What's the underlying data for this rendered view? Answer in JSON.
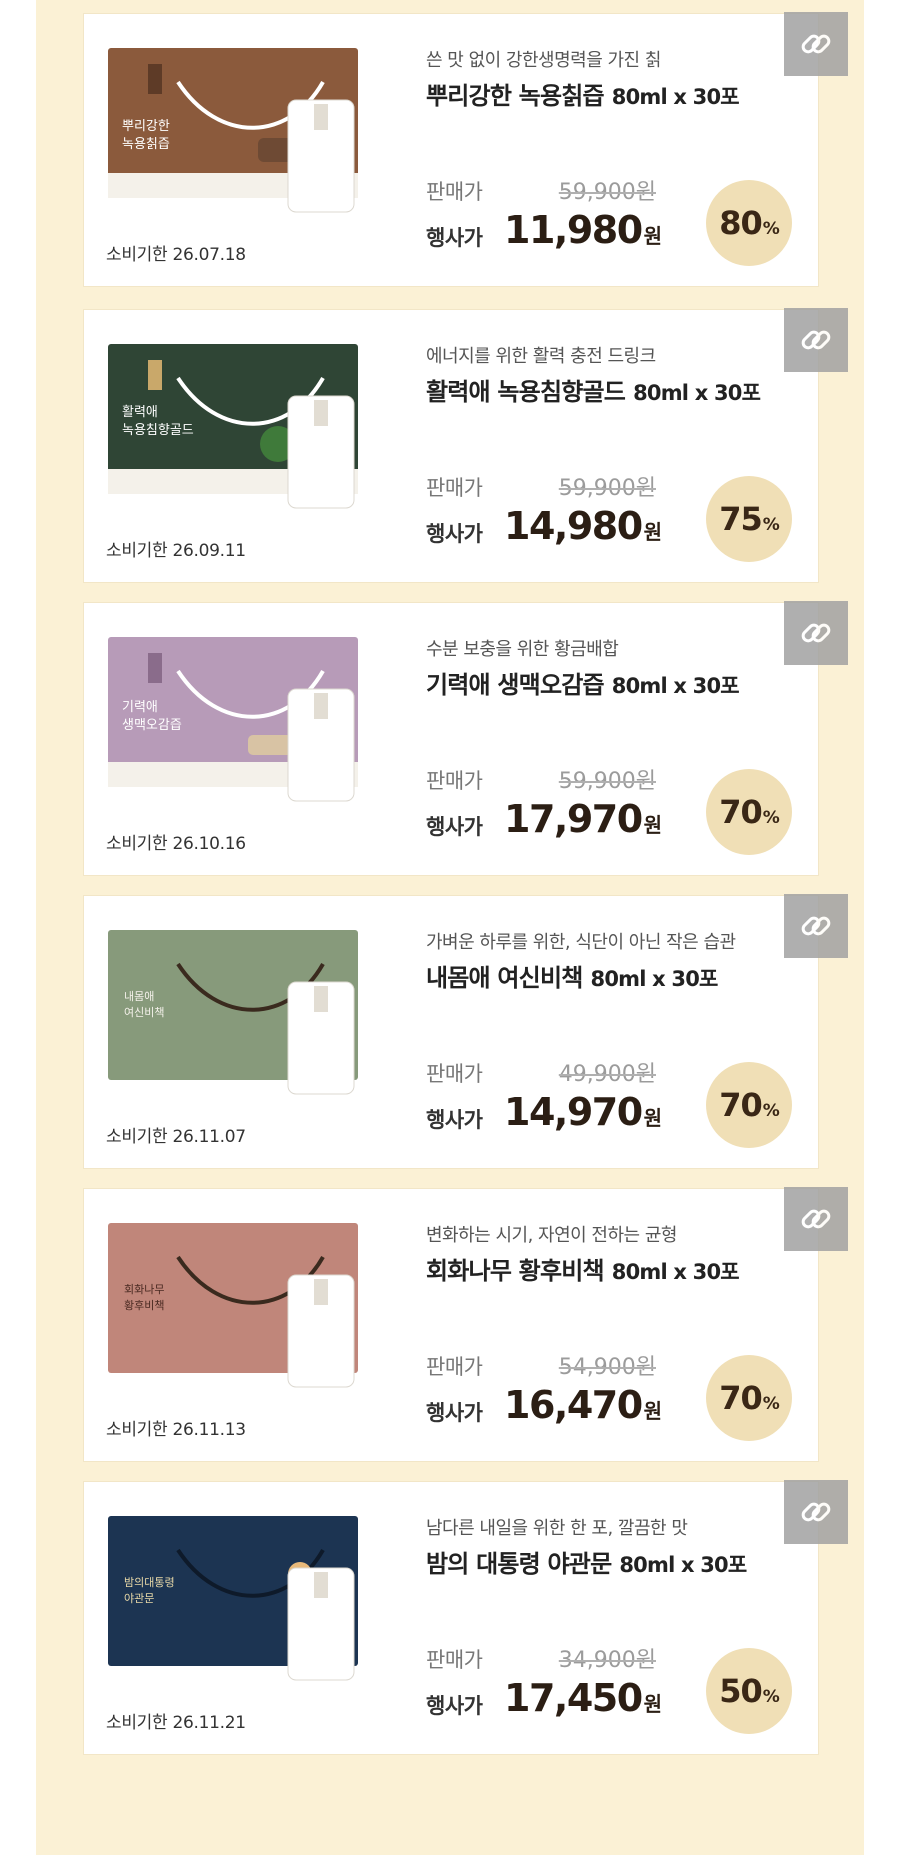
{
  "products": [
    {
      "subtitle": "쓴 맛 없이 강한생명력을 가진 칡",
      "name": "뿌리강한 녹용칡즙",
      "size": "80ml x 30포",
      "sale_label": "판매가",
      "original_price": "59,900원",
      "event_label": "행사가",
      "event_price": "11,980",
      "won": "원",
      "discount": "80",
      "pct": "%",
      "expiry": "소비기한 26.07.18",
      "box_label": "뿌리강한\n녹용칡즙",
      "box_color": "#8b5a3c",
      "link_icon": "link-icon"
    },
    {
      "subtitle": "에너지를 위한 활력 충전 드링크",
      "name": "활력애 녹용침향골드",
      "size": "80ml x 30포",
      "sale_label": "판매가",
      "original_price": "59,900원",
      "event_label": "행사가",
      "event_price": "14,980",
      "won": "원",
      "discount": "75",
      "pct": "%",
      "expiry": "소비기한 26.09.11",
      "box_label": "활력애\n녹용침향골드",
      "box_color": "#2f4535",
      "link_icon": "link-icon"
    },
    {
      "subtitle": "수분 보충을 위한 황금배합",
      "name": "기력애 생맥오감즙",
      "size": "80ml x 30포",
      "sale_label": "판매가",
      "original_price": "59,900원",
      "event_label": "행사가",
      "event_price": "17,970",
      "won": "원",
      "discount": "70",
      "pct": "%",
      "expiry": "소비기한 26.10.16",
      "box_label": "기력애\n생맥오감즙",
      "box_color": "#b79bb8",
      "link_icon": "link-icon"
    },
    {
      "subtitle": "가벼운 하루를 위한, 식단이 아닌 작은 습관",
      "name": "내몸애 여신비책",
      "size": "80ml x 30포",
      "sale_label": "판매가",
      "original_price": "49,900원",
      "event_label": "행사가",
      "event_price": "14,970",
      "won": "원",
      "discount": "70",
      "pct": "%",
      "expiry": "소비기한 26.11.07",
      "box_label": "내몸애\n여신비책",
      "box_color": "#879a7b",
      "link_icon": "link-icon"
    },
    {
      "subtitle": "변화하는 시기, 자연이 전하는 균형",
      "name": "회화나무 황후비책",
      "size": "80ml x 30포",
      "sale_label": "판매가",
      "original_price": "54,900원",
      "event_label": "행사가",
      "event_price": "16,470",
      "won": "원",
      "discount": "70",
      "pct": "%",
      "expiry": "소비기한 26.11.13",
      "box_label": "회화나무\n황후비책",
      "box_color": "#c0867a",
      "link_icon": "link-icon"
    },
    {
      "subtitle": "남다른 내일을 위한 한 포, 깔끔한 맛",
      "name": "밤의 대통령 야관문",
      "size": "80ml x 30포",
      "sale_label": "판매가",
      "original_price": "34,900원",
      "event_label": "행사가",
      "event_price": "17,450",
      "won": "원",
      "discount": "50",
      "pct": "%",
      "expiry": "소비기한 26.11.21",
      "box_label": "밤의대통령\n야관문",
      "box_color": "#1c3452",
      "link_icon": "link-icon"
    }
  ]
}
